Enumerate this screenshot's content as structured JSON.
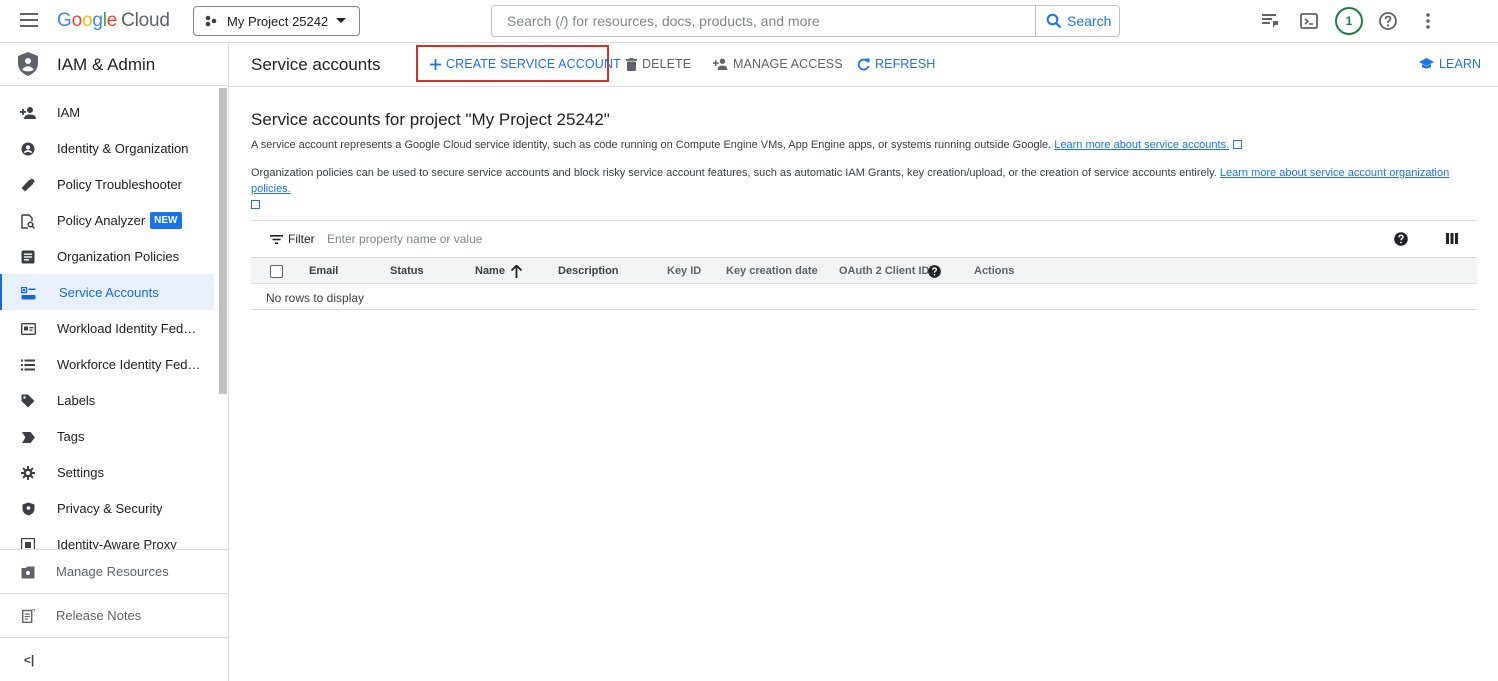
{
  "topbar": {
    "logo_google": "Google",
    "logo_cloud": "Cloud",
    "project_name": "My Project 25242",
    "search_placeholder": "Search (/) for resources, docs, products, and more",
    "search_button": "Search",
    "avatar_count": "1"
  },
  "sidebar": {
    "product_title": "IAM & Admin",
    "items": [
      {
        "label": "IAM",
        "icon": "person-add-icon"
      },
      {
        "label": "Identity & Organization",
        "icon": "account-circle-icon"
      },
      {
        "label": "Policy Troubleshooter",
        "icon": "wrench-icon"
      },
      {
        "label": "Policy Analyzer",
        "icon": "doc-search-icon",
        "badge": "NEW"
      },
      {
        "label": "Organization Policies",
        "icon": "list-doc-icon"
      },
      {
        "label": "Service Accounts",
        "icon": "service-account-icon",
        "active": true
      },
      {
        "label": "Workload Identity Federation",
        "icon": "id-card-icon"
      },
      {
        "label": "Workforce Identity Federation",
        "icon": "list-icon"
      },
      {
        "label": "Labels",
        "icon": "tag-icon"
      },
      {
        "label": "Tags",
        "icon": "label-arrow-icon"
      },
      {
        "label": "Settings",
        "icon": "gear-icon"
      },
      {
        "label": "Privacy & Security",
        "icon": "shield-icon"
      },
      {
        "label": "Identity-Aware Proxy",
        "icon": "iap-icon"
      }
    ],
    "manage_resources": "Manage Resources",
    "release_notes": "Release Notes",
    "collapse_glyph": "<|"
  },
  "actionbar": {
    "title": "Service accounts",
    "create": "CREATE SERVICE ACCOUNT",
    "delete": "DELETE",
    "manage_access": "MANAGE ACCESS",
    "refresh": "REFRESH",
    "learn": "LEARN"
  },
  "main": {
    "heading": "Service accounts for project \"My Project 25242\"",
    "desc1": "A service account represents a Google Cloud service identity, such as code running on Compute Engine VMs, App Engine apps, or systems running outside Google.",
    "desc1_link": "Learn more about service accounts.",
    "desc2": "Organization policies can be used to secure service accounts and block risky service account features, such as automatic IAM Grants, key creation/upload, or the creation of service accounts entirely.",
    "desc2_link": "Learn more about service account organization policies.",
    "filter_label": "Filter",
    "filter_placeholder": "Enter property name or value",
    "columns": [
      "Email",
      "Status",
      "Name",
      "Description",
      "Key ID",
      "Key creation date",
      "OAuth 2 Client ID",
      "Actions"
    ],
    "empty_text": "No rows to display"
  },
  "colors": {
    "accent": "#1a73e8",
    "highlight": "#d93025",
    "active_bg": "#e8f0fe"
  }
}
